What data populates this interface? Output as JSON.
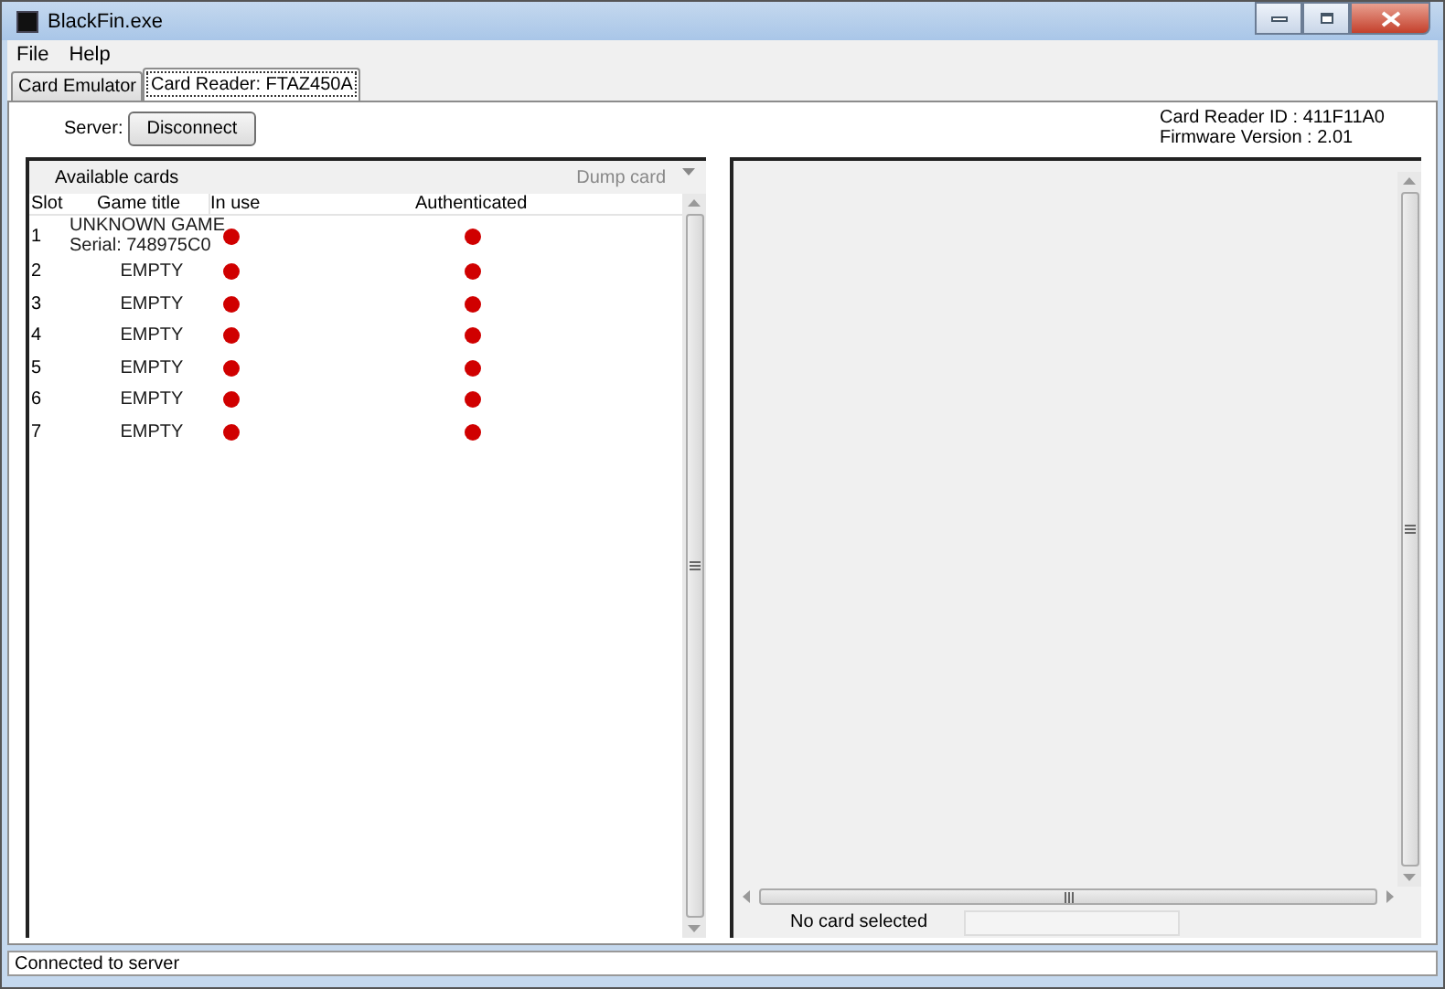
{
  "window": {
    "title": "BlackFin.exe"
  },
  "menu": [
    {
      "label": "File"
    },
    {
      "label": "Help"
    }
  ],
  "tabs": [
    {
      "label": "Card Emulator",
      "selected": false
    },
    {
      "label": "Card Reader: FTAZ450A",
      "selected": true
    }
  ],
  "server": {
    "label": "Server:",
    "button": "Disconnect"
  },
  "reader_info": [
    "Card Reader ID : 411F11A0",
    "Firmware Version : 2.01"
  ],
  "cards": {
    "title": "Available cards",
    "dump_button": {
      "label": "Dump card",
      "disabled": true
    },
    "columns": [
      "Slot",
      "Game title",
      "In use",
      "Authenticated"
    ],
    "rows": [
      {
        "slot": "1",
        "title": "UNKNOWN GAME",
        "serial": "Serial: 748975C0",
        "in_use": false,
        "authenticated": false
      },
      {
        "slot": "2",
        "title": "EMPTY",
        "in_use": false,
        "authenticated": false
      },
      {
        "slot": "3",
        "title": "EMPTY",
        "in_use": false,
        "authenticated": false
      },
      {
        "slot": "4",
        "title": "EMPTY",
        "in_use": false,
        "authenticated": false
      },
      {
        "slot": "5",
        "title": "EMPTY",
        "in_use": false,
        "authenticated": false
      },
      {
        "slot": "6",
        "title": "EMPTY",
        "in_use": false,
        "authenticated": false
      },
      {
        "slot": "7",
        "title": "EMPTY",
        "in_use": false,
        "authenticated": false
      }
    ]
  },
  "detail": {
    "status": "No card selected"
  },
  "status_bar": "Connected to server"
}
